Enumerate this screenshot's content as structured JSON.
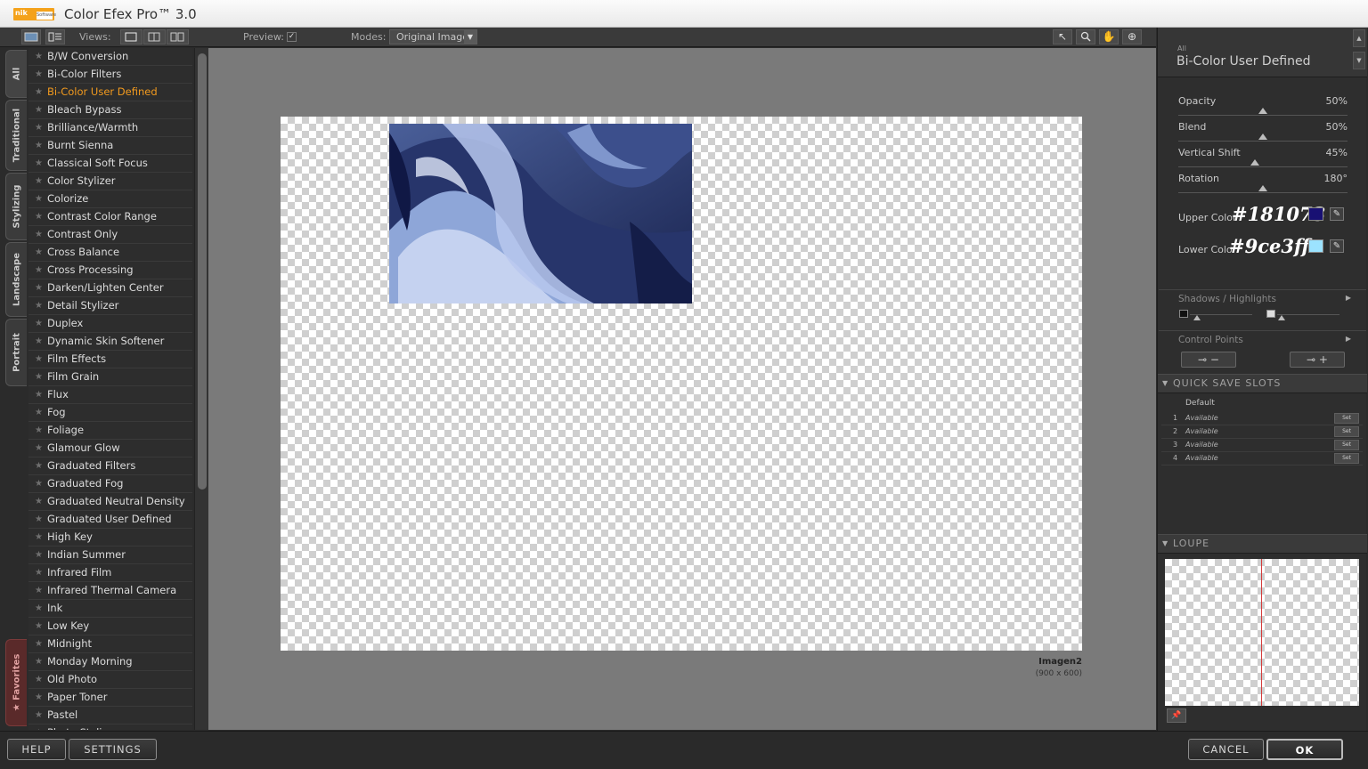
{
  "app": {
    "title": "Color Efex Pro™ 3.0",
    "logo_text": "nik",
    "logo_sub": "Software"
  },
  "toolbar": {
    "views_label": "Views:",
    "preview_label": "Preview:",
    "preview_checked": true,
    "modes_label": "Modes:",
    "modes_value": "Original Image",
    "tool_icons": [
      "arrow-pointer-icon",
      "zoom-icon",
      "hand-icon",
      "control-point-icon"
    ]
  },
  "category_tabs": [
    "All",
    "Traditional",
    "Stylizing",
    "Landscape",
    "Portrait",
    "Favorites"
  ],
  "filters": {
    "active": "Bi-Color User Defined",
    "items": [
      "B/W Conversion",
      "Bi-Color Filters",
      "Bi-Color User Defined",
      "Bleach Bypass",
      "Brilliance/Warmth",
      "Burnt Sienna",
      "Classical Soft Focus",
      "Color Stylizer",
      "Colorize",
      "Contrast Color Range",
      "Contrast Only",
      "Cross Balance",
      "Cross Processing",
      "Darken/Lighten Center",
      "Detail Stylizer",
      "Duplex",
      "Dynamic Skin Softener",
      "Film Effects",
      "Film Grain",
      "Flux",
      "Fog",
      "Foliage",
      "Glamour Glow",
      "Graduated Filters",
      "Graduated Fog",
      "Graduated Neutral Density",
      "Graduated User Defined",
      "High Key",
      "Indian Summer",
      "Infrared Film",
      "Infrared Thermal Camera",
      "Ink",
      "Low Key",
      "Midnight",
      "Monday Morning",
      "Old Photo",
      "Paper Toner",
      "Pastel",
      "Photo Stylizer"
    ]
  },
  "document": {
    "name": "Imagen2",
    "size": "(900 x 600)"
  },
  "panel": {
    "category": "All",
    "filter_name": "Bi-Color User Defined",
    "params": [
      {
        "label": "Opacity",
        "value": "50%",
        "fraction": 0.5
      },
      {
        "label": "Blend",
        "value": "50%",
        "fraction": 0.5
      },
      {
        "label": "Vertical Shift",
        "value": "45%",
        "fraction": 0.45
      },
      {
        "label": "Rotation",
        "value": "180°",
        "fraction": 0.5
      }
    ],
    "upper_color": {
      "label": "Upper Color",
      "hex_overlay": "#181073",
      "swatch": "#181073"
    },
    "lower_color": {
      "label": "Lower Color",
      "hex_overlay": "#9ce3ff",
      "swatch": "#9ce3ff"
    },
    "shadows_highlights_label": "Shadows / Highlights",
    "control_points_label": "Control Points",
    "quick_save": {
      "header": "QUICK SAVE SLOTS",
      "default_label": "Default",
      "set_label": "Set",
      "slots": [
        {
          "num": "1",
          "status": "Available"
        },
        {
          "num": "2",
          "status": "Available"
        },
        {
          "num": "3",
          "status": "Available"
        },
        {
          "num": "4",
          "status": "Available"
        }
      ]
    },
    "loupe_header": "LOUPE"
  },
  "buttons": {
    "help": "HELP",
    "settings": "SETTINGS",
    "cancel": "CANCEL",
    "ok": "OK"
  },
  "colors": {
    "accent": "#f29a1e",
    "upper": "#181073",
    "lower": "#9ce3ff"
  }
}
